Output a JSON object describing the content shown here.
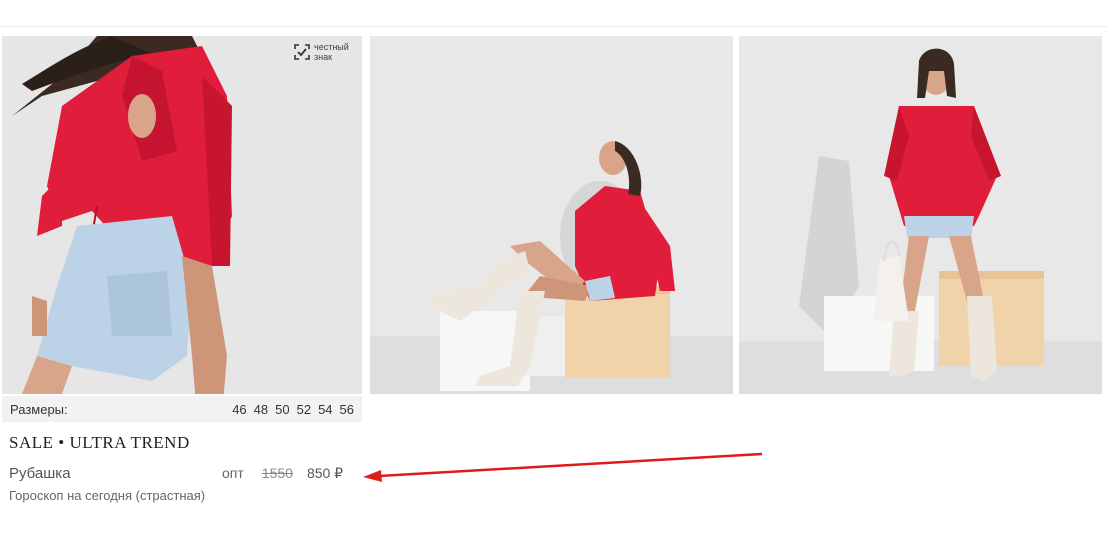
{
  "badge": {
    "line1": "честный",
    "line2": "знак",
    "icon": "honest-sign-icon"
  },
  "sizes": {
    "label": "Размеры:",
    "items": [
      "46",
      "48",
      "50",
      "52",
      "54",
      "56"
    ]
  },
  "product": {
    "brand": "SALE • ULTRA TREND",
    "name": "Рубашка",
    "description": "Гороскоп на сегодня (страстная)"
  },
  "price": {
    "label": "опт",
    "old": "1550",
    "current": "850 ₽"
  },
  "colors": {
    "shirt_red": "#e01e3c",
    "annotation_arrow": "#e01b1b",
    "photo_background": "#e9e9e9"
  }
}
